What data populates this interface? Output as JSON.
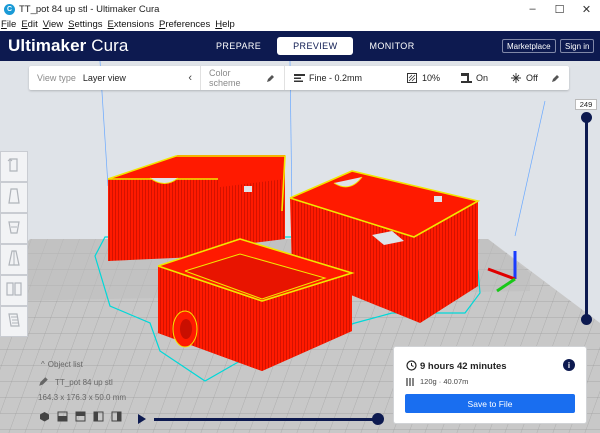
{
  "window": {
    "title": "TT_pot 84 up stl - Ultimaker Cura",
    "app_icon": "cura-app-icon",
    "minimize": "–",
    "maximize": "☐",
    "close": "✕"
  },
  "menu": {
    "items": [
      {
        "prefix": "F",
        "rest": "ile"
      },
      {
        "prefix": "E",
        "rest": "dit"
      },
      {
        "prefix": "V",
        "rest": "iew"
      },
      {
        "prefix": "S",
        "rest": "ettings"
      },
      {
        "prefix": "E",
        "rest": "xtensions"
      },
      {
        "prefix": "P",
        "rest": "references"
      },
      {
        "prefix": "H",
        "rest": "elp"
      }
    ]
  },
  "header": {
    "logo_bold": "Ultimaker",
    "logo_thin": " Cura",
    "tabs": [
      {
        "label": "PREPARE",
        "active": false
      },
      {
        "label": "PREVIEW",
        "active": true
      },
      {
        "label": "MONITOR",
        "active": false
      }
    ],
    "marketplace_label": "Marketplace",
    "signin_label": "Sign in"
  },
  "toolbar": {
    "view_type_label": "View type",
    "view_type_value": "Layer view",
    "color_scheme_label": "Color scheme",
    "profile": "Fine - 0.2mm",
    "infill": "10%",
    "support": "On",
    "adhesion": "Off"
  },
  "layer_slider": {
    "current_layer": "249"
  },
  "object_list": {
    "heading": "Object list",
    "file_name": "TT_pot 84 up stl",
    "dimensions": "164.3 x 176.3 x 50.0 mm"
  },
  "print_info": {
    "time": "9 hours 42 minutes",
    "filament": "120g · 40.07m",
    "save_label": "Save to File",
    "info_glyph": "i"
  },
  "colors": {
    "header_bg": "#0d1a50",
    "save_button": "#196ef0",
    "model_wall": "#ff1a00",
    "inner_wall": "#f2e600",
    "travel_cyan": "#00d8d8",
    "build_plate": "#c9c9c9"
  }
}
